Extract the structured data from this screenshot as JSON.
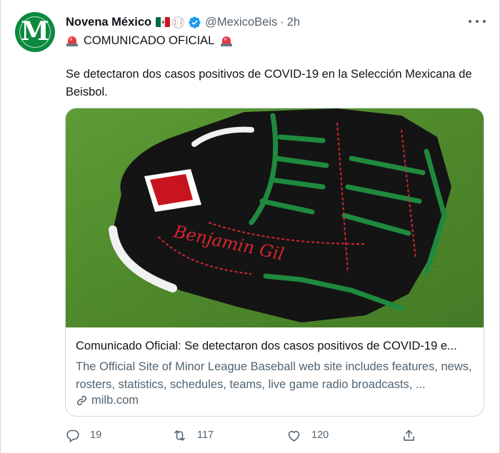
{
  "tweet": {
    "avatar_letter": "M",
    "display_name": "Novena México",
    "name_emojis": [
      "mexico-flag",
      "baseball"
    ],
    "handle": "@MexicoBeis",
    "separator": "·",
    "time": "2h",
    "headline": "COMUNICADO OFICIAL",
    "headline_emoji": "police-siren",
    "text": "Se detectaron dos casos positivos de COVID-19 en la Selección Mexicana de Beisbol."
  },
  "card": {
    "image_alt": "Baseball glove with green laces and red \"Benjamin Gil\" stitching on grass",
    "glove_embroidery": "Benjamin Gil",
    "title": "Comunicado Oficial: Se detectaron dos casos positivos de COVID-19 e...",
    "description": "The Official Site of Minor League Baseball web site includes features, news, rosters, statistics, schedules, teams, live game radio broadcasts, ...",
    "domain": "milb.com"
  },
  "actions": {
    "replies": "19",
    "retweets": "117",
    "likes": "120"
  },
  "colors": {
    "avatar_green": "#0b8a3e",
    "verified_blue": "#1d9bf0",
    "muted_text": "#536471",
    "border": "#cfd9de"
  }
}
